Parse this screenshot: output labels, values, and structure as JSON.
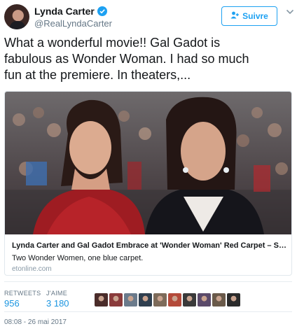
{
  "header": {
    "display_name": "Lynda Carter",
    "handle": "@RealLyndaCarter",
    "verified_icon": "verified-badge-icon",
    "follow_label": "Suivre",
    "follow_icon": "add-user-icon",
    "more_icon": "chevron-down-icon"
  },
  "tweet": {
    "text": "What a wonderful movie!! Gal Gadot is\nfabulous as Wonder Woman. I had so much\nfun at the premiere. In theaters,..."
  },
  "card": {
    "title": "Lynda Carter and Gal Gadot Embrace at 'Wonder Woman' Red Carpet – See th...",
    "description": "Two Wonder Women, one blue carpet.",
    "domain": "etonline.com"
  },
  "stats": {
    "retweets_label": "RETWEETS",
    "retweets_value": "956",
    "likes_label": "J'AIME",
    "likes_value": "3 180",
    "liker_avatars": [
      "#4a2c2a",
      "#8a3b3b",
      "#6b7b8c",
      "#2f3f4f",
      "#7d6b5a",
      "#b44a3a",
      "#3a3a3a",
      "#5b4a6a",
      "#6a5a4a",
      "#2b2b2b"
    ]
  },
  "footer": {
    "timestamp": "08:08 - 26 mai 2017"
  },
  "colors": {
    "accent": "#1da1f2",
    "link": "#1b95e0",
    "muted": "#657786"
  }
}
